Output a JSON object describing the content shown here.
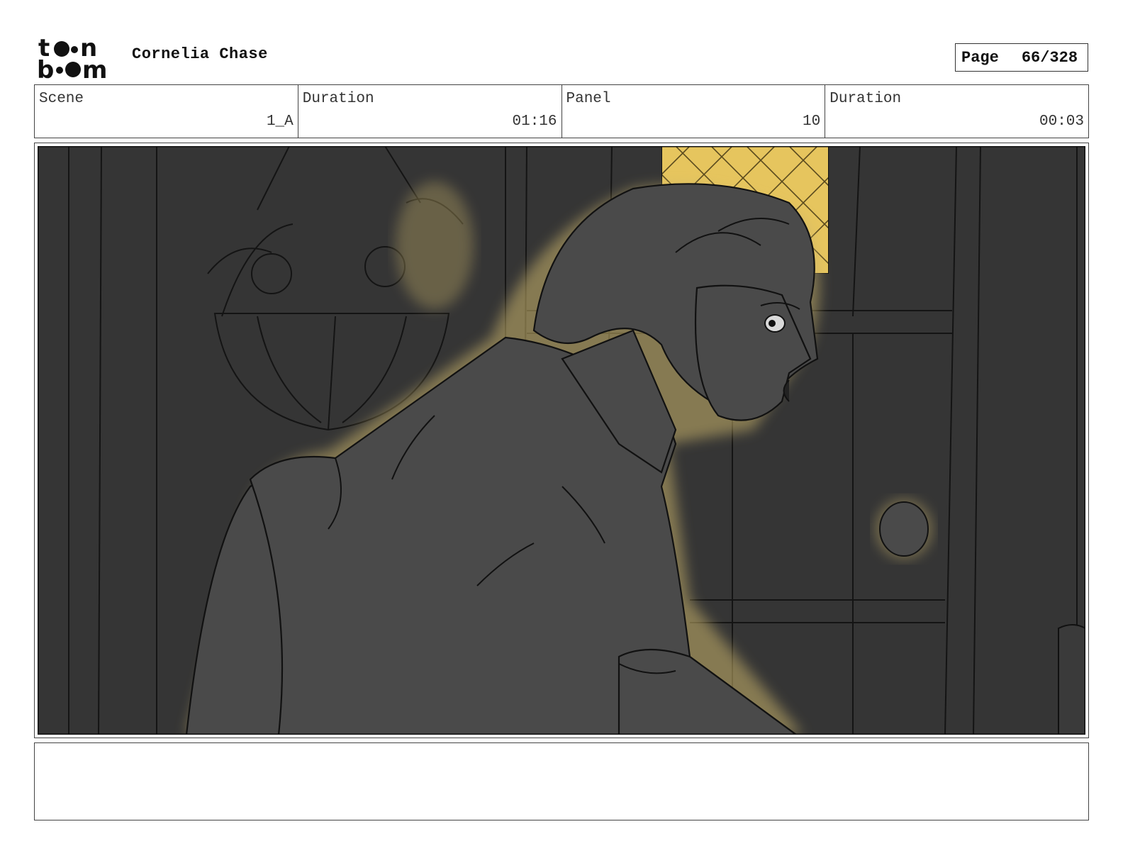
{
  "header": {
    "logo_text": "toonboom",
    "project_title": "Cornelia Chase",
    "page_label": "Page",
    "page_value": "66/328"
  },
  "info": {
    "scene_label": "Scene",
    "scene_value": "1_A",
    "scene_duration_label": "Duration",
    "scene_duration_value": "01:16",
    "panel_label": "Panel",
    "panel_value": "10",
    "panel_duration_label": "Duration",
    "panel_duration_value": "00:03"
  },
  "colors": {
    "background_dark": "#333333",
    "figure_gray": "#4a4a4a",
    "glow_gold": "#c9b36a",
    "window_yellow": "#e6c55e",
    "line_black": "#111111"
  },
  "notes": {
    "text": ""
  }
}
